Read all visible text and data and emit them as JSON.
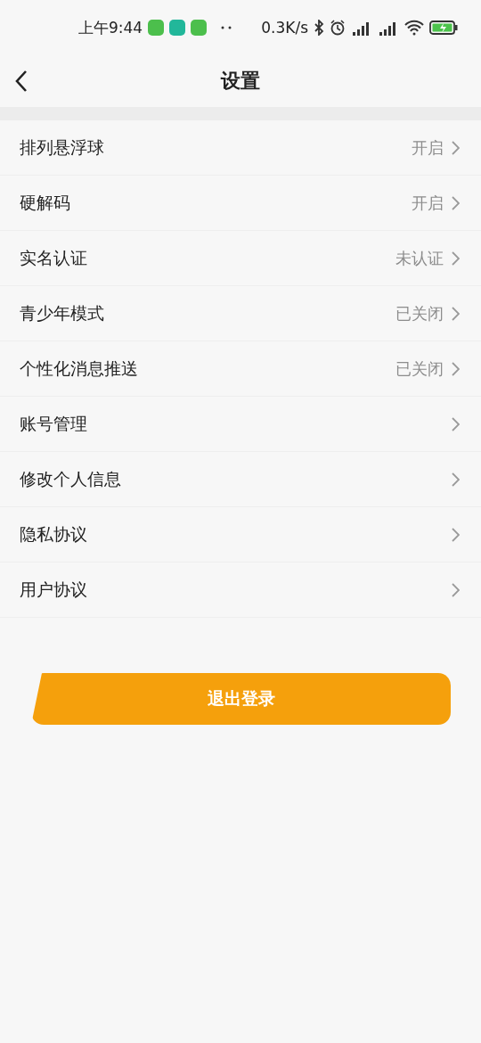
{
  "status_bar": {
    "time": "上午9:44",
    "net_speed": "0.3K/s"
  },
  "header": {
    "title": "设置"
  },
  "settings": [
    {
      "label": "排列悬浮球",
      "value": "开启"
    },
    {
      "label": "硬解码",
      "value": "开启"
    },
    {
      "label": "实名认证",
      "value": "未认证"
    },
    {
      "label": "青少年模式",
      "value": "已关闭"
    },
    {
      "label": "个性化消息推送",
      "value": "已关闭"
    },
    {
      "label": "账号管理"
    },
    {
      "label": "修改个人信息"
    },
    {
      "label": "隐私协议"
    },
    {
      "label": "用户协议"
    }
  ],
  "logout_button": "退出登录"
}
